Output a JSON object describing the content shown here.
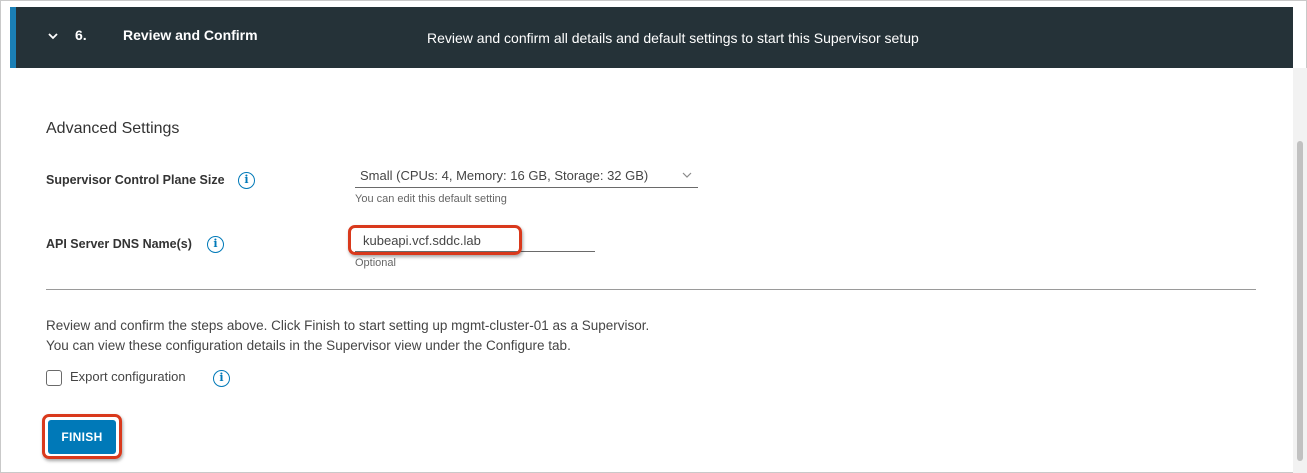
{
  "header": {
    "step_number": "6.",
    "step_title": "Review and Confirm",
    "step_description": "Review and confirm all details and default settings to start this Supervisor setup",
    "background_color": "#253238",
    "accent_color": "#1b7fb5"
  },
  "advanced_settings": {
    "title": "Advanced Settings",
    "control_plane_size": {
      "label": "Supervisor Control Plane Size",
      "info_icon": "info-circle-icon",
      "value": "Small (CPUs: 4, Memory: 16 GB, Storage: 32 GB)",
      "helper": "You can edit this default setting"
    },
    "api_dns": {
      "label": "API Server DNS Name(s)",
      "info_icon": "info-circle-icon",
      "value": "kubeapi.vcf.sddc.lab",
      "helper": "Optional"
    }
  },
  "review": {
    "line1": "Review and confirm the steps above. Click Finish to start setting up mgmt-cluster-01 as a Supervisor.",
    "line2": "You can view these configuration details in the Supervisor view under the Configure tab.",
    "export_label": "Export configuration",
    "export_checked": false
  },
  "actions": {
    "finish_label": "FINISH",
    "primary_color": "#0079b8",
    "highlight_color": "#d9391c"
  }
}
